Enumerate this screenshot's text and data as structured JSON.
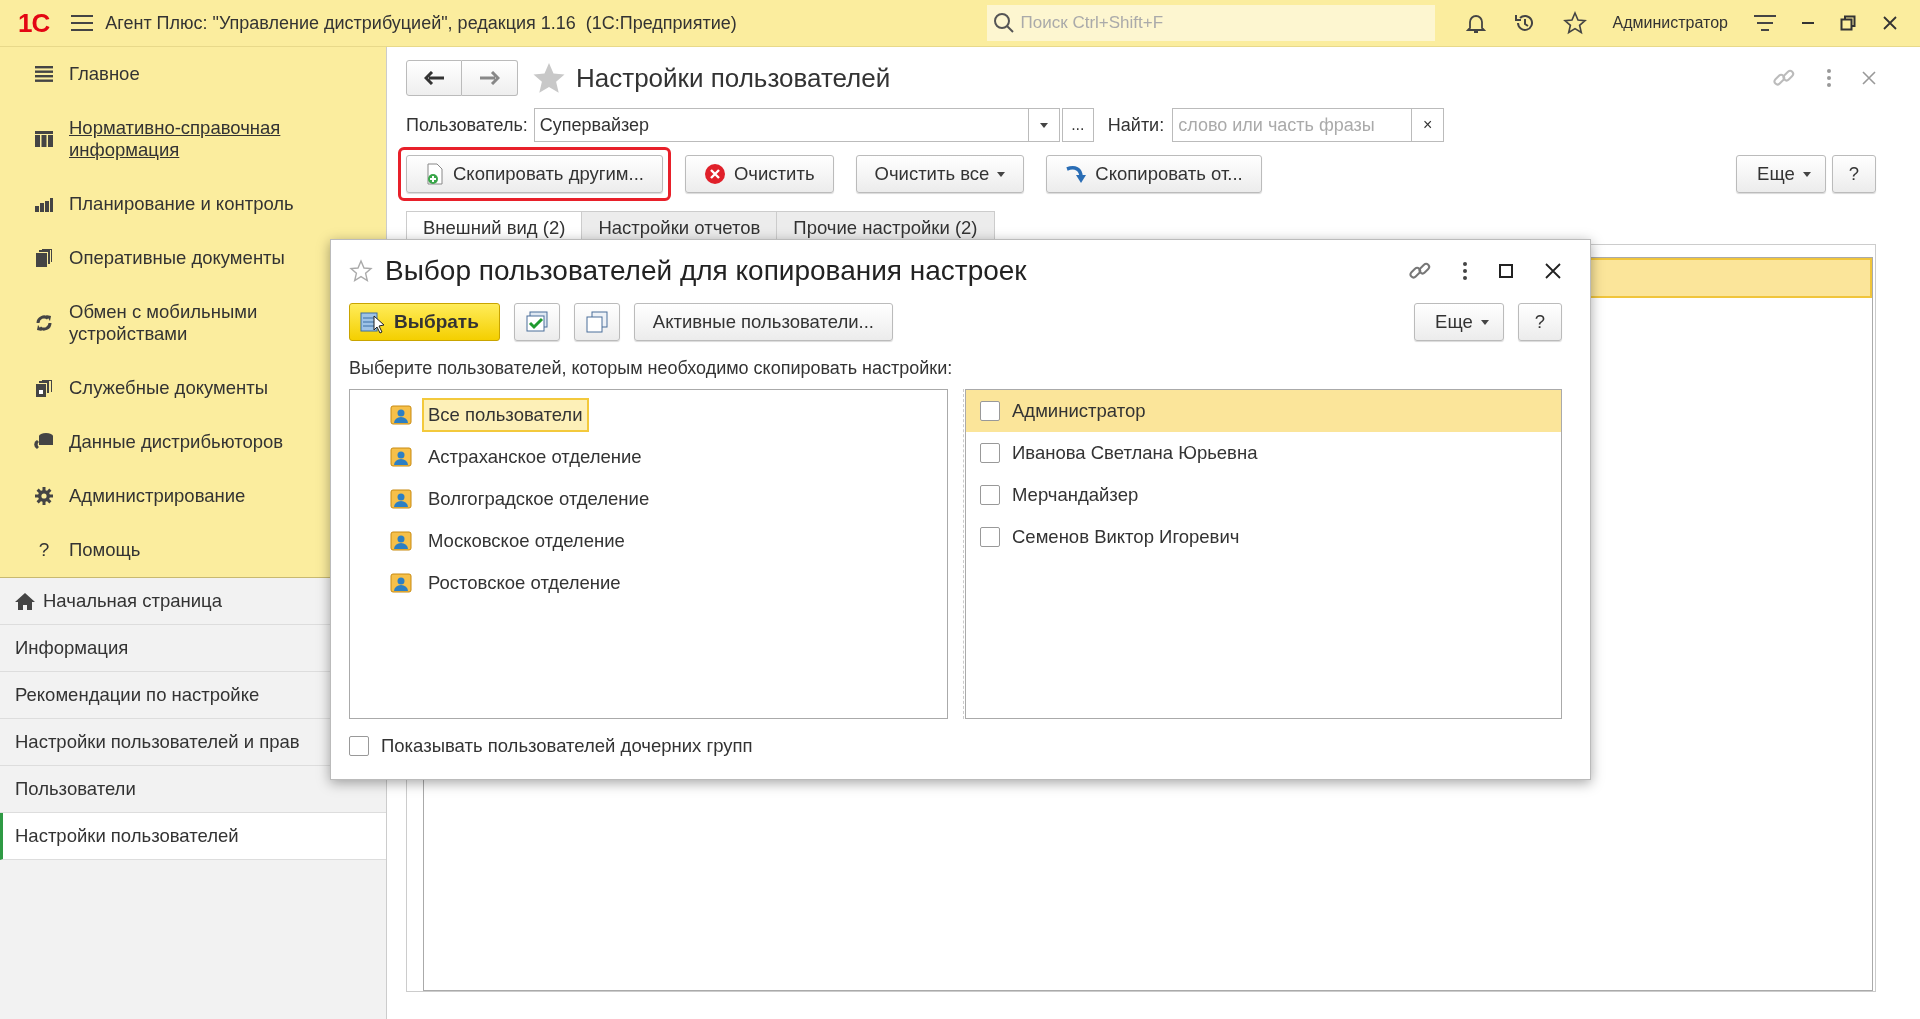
{
  "titlebar": {
    "logo": "1С",
    "title": "Агент Плюс: \"Управление дистрибуцией\", редакция 1.16  (1С:Предприятие)",
    "search": {
      "placeholder": "Поиск Ctrl+Shift+F"
    },
    "user": "Администратор"
  },
  "sections": [
    {
      "label": "Главное",
      "selected": false,
      "kind": "lines"
    },
    {
      "label": "Нормативно-справочная информация",
      "selected": true,
      "kind": "columns"
    },
    {
      "label": "Планирование и контроль",
      "selected": false,
      "kind": "chart"
    },
    {
      "label": "Оперативные документы",
      "selected": false,
      "kind": "docs"
    },
    {
      "label": "Обмен с мобильными устройствами",
      "selected": false,
      "kind": "sync"
    },
    {
      "label": "Служебные документы",
      "selected": false,
      "kind": "service"
    },
    {
      "label": "Данные дистрибьюторов",
      "selected": false,
      "kind": "data"
    },
    {
      "label": "Администрирование",
      "selected": false,
      "kind": "gear"
    },
    {
      "label": "Помощь",
      "selected": false,
      "kind": "glyph",
      "glyph": "?"
    }
  ],
  "nav": [
    {
      "label": "Начальная страница",
      "selected": false,
      "kind": "home"
    },
    {
      "label": "Информация",
      "selected": false,
      "kind": "plain"
    },
    {
      "label": "Рекомендации по настройке",
      "selected": false,
      "kind": "plain"
    },
    {
      "label": "Настройки пользователей и прав",
      "selected": false,
      "kind": "plain"
    },
    {
      "label": "Пользователи",
      "selected": false,
      "kind": "plain"
    },
    {
      "label": "Настройки пользователей",
      "selected": true,
      "kind": "plain"
    }
  ],
  "form": {
    "title": "Настройки пользователей",
    "user_label": "Пользователь:",
    "user_value": "Супервайзер",
    "choose": "...",
    "find_label": "Найти:",
    "find": {
      "placeholder": "слово или часть фразы"
    },
    "clear": "×",
    "buttons": [
      {
        "label": "Скопировать другим...",
        "kind": "add",
        "highlighted": true
      },
      {
        "label": "Очистить",
        "kind": "clear",
        "highlighted": false
      },
      {
        "label": "Очистить все",
        "kind": "menu",
        "highlighted": false
      },
      {
        "label": "Скопировать от...",
        "kind": "import",
        "highlighted": false
      }
    ],
    "more_button": "Еще",
    "help": "?",
    "tabs": [
      {
        "label": "Внешний вид (2)",
        "selected": true
      },
      {
        "label": "Настройки отчетов",
        "selected": false
      },
      {
        "label": "Прочие настройки (2)",
        "selected": false
      }
    ]
  },
  "dialog": {
    "title": "Выбор пользователей для копирования настроек",
    "select_button": "Выбрать",
    "active_button": "Активные пользователи...",
    "more_button": "Еще",
    "help": "?",
    "prompt": "Выберите пользователей, которым необходимо скопировать настройки:",
    "groups": [
      {
        "label": "Все пользователи",
        "selected": true
      },
      {
        "label": "Астраханское отделение",
        "selected": false
      },
      {
        "label": "Волгоградское отделение",
        "selected": false
      },
      {
        "label": "Московское отделение",
        "selected": false
      },
      {
        "label": "Ростовское отделение",
        "selected": false
      }
    ],
    "users": [
      {
        "name": "Администратор",
        "selected": true,
        "checked": false
      },
      {
        "name": "Иванова Светлана Юрьевна",
        "selected": false,
        "checked": false
      },
      {
        "name": "Мерчандайзер",
        "selected": false,
        "checked": false
      },
      {
        "name": "Семенов Виктор Игоревич",
        "selected": false,
        "checked": false
      }
    ],
    "show_subgroups": {
      "label": "Показывать пользователей дочерних групп",
      "checked": false
    }
  }
}
